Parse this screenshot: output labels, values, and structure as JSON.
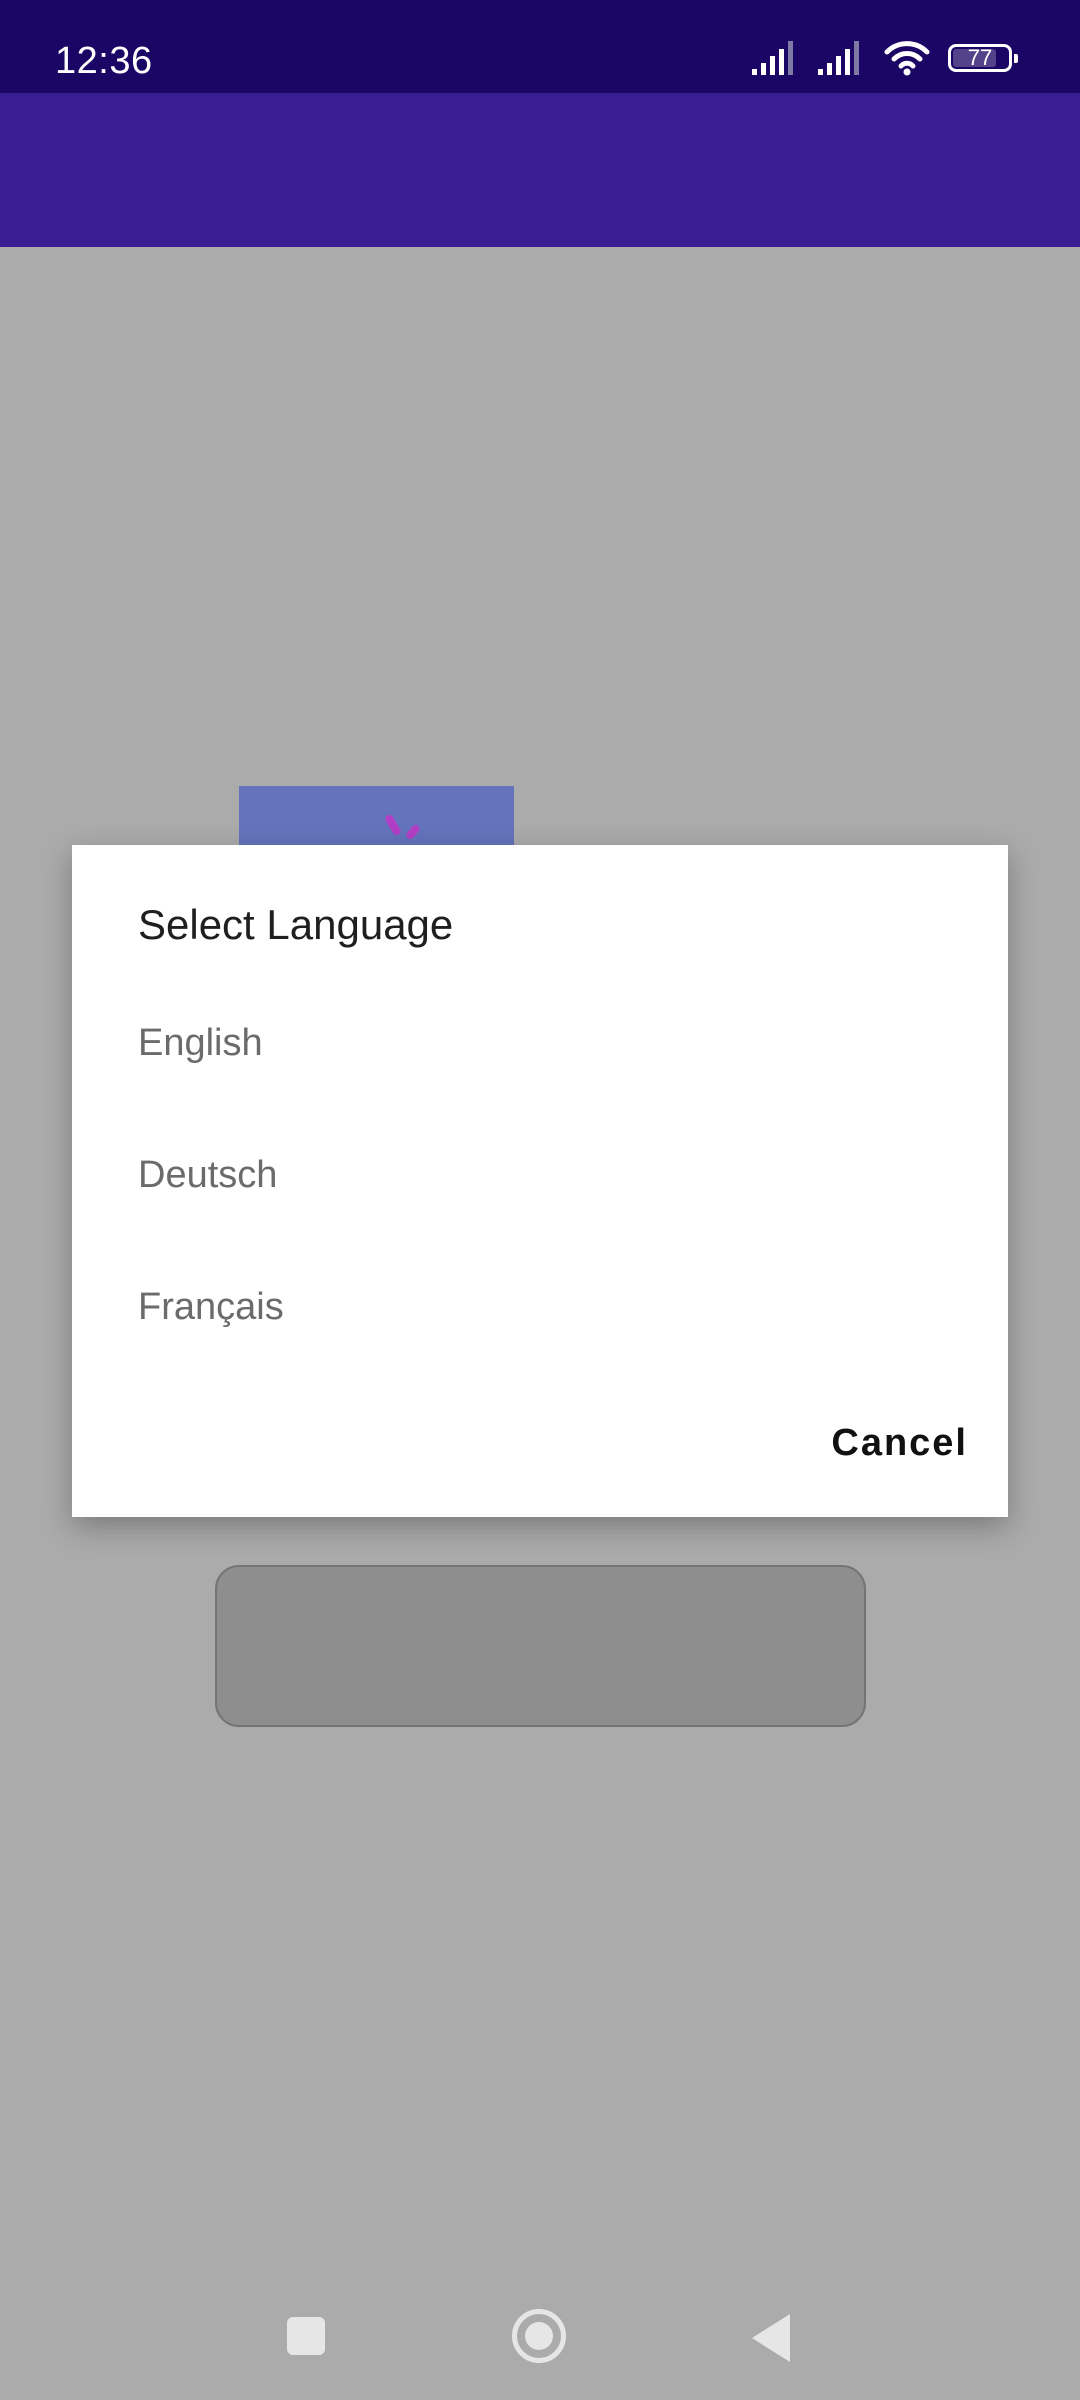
{
  "status_bar": {
    "time": "12:36",
    "battery": "77",
    "icons": [
      "cell-signal-icon",
      "cell-signal-icon",
      "wifi-icon",
      "battery-icon"
    ]
  },
  "dialog": {
    "title": "Select Language",
    "options": [
      {
        "label": "English"
      },
      {
        "label": "Deutsch"
      },
      {
        "label": "Français"
      }
    ],
    "cancel_label": "Cancel"
  },
  "nav_bar": {
    "icons": [
      "recents-icon",
      "home-icon",
      "back-icon"
    ]
  },
  "colors": {
    "status_bar": "#1b0565",
    "app_bar": "#3a1c93",
    "scrim_background": "#ababab",
    "dialog": "#ffffff"
  }
}
